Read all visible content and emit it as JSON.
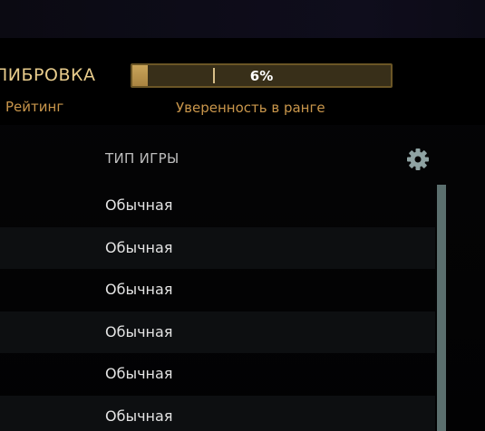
{
  "calibration": {
    "label": "ЛИБРОВКА",
    "progress_percent": 6,
    "progress_text": "6%"
  },
  "labels": {
    "rating": "Рейтинг",
    "confidence": "Уверенность в ранге"
  },
  "table": {
    "column_header": "ТИП ИГРЫ",
    "settings_icon": "gear-icon",
    "rows": [
      {
        "game_type": "Обычная"
      },
      {
        "game_type": "Обычная"
      },
      {
        "game_type": "Обычная"
      },
      {
        "game_type": "Обычная"
      },
      {
        "game_type": "Обычная"
      },
      {
        "game_type": "Обычная"
      }
    ]
  },
  "colors": {
    "accent_gold": "#e8cc8c",
    "label_orange": "#c9964b",
    "scrollbar": "#5b6f6e"
  }
}
